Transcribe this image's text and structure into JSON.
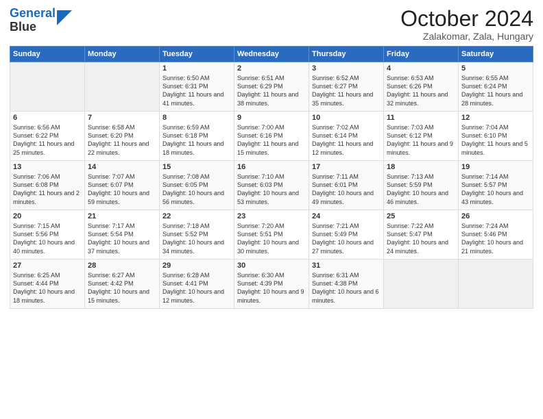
{
  "header": {
    "logo_line1": "General",
    "logo_line2": "Blue",
    "title": "October 2024",
    "subtitle": "Zalakomar, Zala, Hungary"
  },
  "days_of_week": [
    "Sunday",
    "Monday",
    "Tuesday",
    "Wednesday",
    "Thursday",
    "Friday",
    "Saturday"
  ],
  "weeks": [
    [
      {
        "day": "",
        "content": ""
      },
      {
        "day": "",
        "content": ""
      },
      {
        "day": "1",
        "content": "Sunrise: 6:50 AM\nSunset: 6:31 PM\nDaylight: 11 hours and 41 minutes."
      },
      {
        "day": "2",
        "content": "Sunrise: 6:51 AM\nSunset: 6:29 PM\nDaylight: 11 hours and 38 minutes."
      },
      {
        "day": "3",
        "content": "Sunrise: 6:52 AM\nSunset: 6:27 PM\nDaylight: 11 hours and 35 minutes."
      },
      {
        "day": "4",
        "content": "Sunrise: 6:53 AM\nSunset: 6:26 PM\nDaylight: 11 hours and 32 minutes."
      },
      {
        "day": "5",
        "content": "Sunrise: 6:55 AM\nSunset: 6:24 PM\nDaylight: 11 hours and 28 minutes."
      }
    ],
    [
      {
        "day": "6",
        "content": "Sunrise: 6:56 AM\nSunset: 6:22 PM\nDaylight: 11 hours and 25 minutes."
      },
      {
        "day": "7",
        "content": "Sunrise: 6:58 AM\nSunset: 6:20 PM\nDaylight: 11 hours and 22 minutes."
      },
      {
        "day": "8",
        "content": "Sunrise: 6:59 AM\nSunset: 6:18 PM\nDaylight: 11 hours and 18 minutes."
      },
      {
        "day": "9",
        "content": "Sunrise: 7:00 AM\nSunset: 6:16 PM\nDaylight: 11 hours and 15 minutes."
      },
      {
        "day": "10",
        "content": "Sunrise: 7:02 AM\nSunset: 6:14 PM\nDaylight: 11 hours and 12 minutes."
      },
      {
        "day": "11",
        "content": "Sunrise: 7:03 AM\nSunset: 6:12 PM\nDaylight: 11 hours and 9 minutes."
      },
      {
        "day": "12",
        "content": "Sunrise: 7:04 AM\nSunset: 6:10 PM\nDaylight: 11 hours and 5 minutes."
      }
    ],
    [
      {
        "day": "13",
        "content": "Sunrise: 7:06 AM\nSunset: 6:08 PM\nDaylight: 11 hours and 2 minutes."
      },
      {
        "day": "14",
        "content": "Sunrise: 7:07 AM\nSunset: 6:07 PM\nDaylight: 10 hours and 59 minutes."
      },
      {
        "day": "15",
        "content": "Sunrise: 7:08 AM\nSunset: 6:05 PM\nDaylight: 10 hours and 56 minutes."
      },
      {
        "day": "16",
        "content": "Sunrise: 7:10 AM\nSunset: 6:03 PM\nDaylight: 10 hours and 53 minutes."
      },
      {
        "day": "17",
        "content": "Sunrise: 7:11 AM\nSunset: 6:01 PM\nDaylight: 10 hours and 49 minutes."
      },
      {
        "day": "18",
        "content": "Sunrise: 7:13 AM\nSunset: 5:59 PM\nDaylight: 10 hours and 46 minutes."
      },
      {
        "day": "19",
        "content": "Sunrise: 7:14 AM\nSunset: 5:57 PM\nDaylight: 10 hours and 43 minutes."
      }
    ],
    [
      {
        "day": "20",
        "content": "Sunrise: 7:15 AM\nSunset: 5:56 PM\nDaylight: 10 hours and 40 minutes."
      },
      {
        "day": "21",
        "content": "Sunrise: 7:17 AM\nSunset: 5:54 PM\nDaylight: 10 hours and 37 minutes."
      },
      {
        "day": "22",
        "content": "Sunrise: 7:18 AM\nSunset: 5:52 PM\nDaylight: 10 hours and 34 minutes."
      },
      {
        "day": "23",
        "content": "Sunrise: 7:20 AM\nSunset: 5:51 PM\nDaylight: 10 hours and 30 minutes."
      },
      {
        "day": "24",
        "content": "Sunrise: 7:21 AM\nSunset: 5:49 PM\nDaylight: 10 hours and 27 minutes."
      },
      {
        "day": "25",
        "content": "Sunrise: 7:22 AM\nSunset: 5:47 PM\nDaylight: 10 hours and 24 minutes."
      },
      {
        "day": "26",
        "content": "Sunrise: 7:24 AM\nSunset: 5:46 PM\nDaylight: 10 hours and 21 minutes."
      }
    ],
    [
      {
        "day": "27",
        "content": "Sunrise: 6:25 AM\nSunset: 4:44 PM\nDaylight: 10 hours and 18 minutes."
      },
      {
        "day": "28",
        "content": "Sunrise: 6:27 AM\nSunset: 4:42 PM\nDaylight: 10 hours and 15 minutes."
      },
      {
        "day": "29",
        "content": "Sunrise: 6:28 AM\nSunset: 4:41 PM\nDaylight: 10 hours and 12 minutes."
      },
      {
        "day": "30",
        "content": "Sunrise: 6:30 AM\nSunset: 4:39 PM\nDaylight: 10 hours and 9 minutes."
      },
      {
        "day": "31",
        "content": "Sunrise: 6:31 AM\nSunset: 4:38 PM\nDaylight: 10 hours and 6 minutes."
      },
      {
        "day": "",
        "content": ""
      },
      {
        "day": "",
        "content": ""
      }
    ]
  ]
}
